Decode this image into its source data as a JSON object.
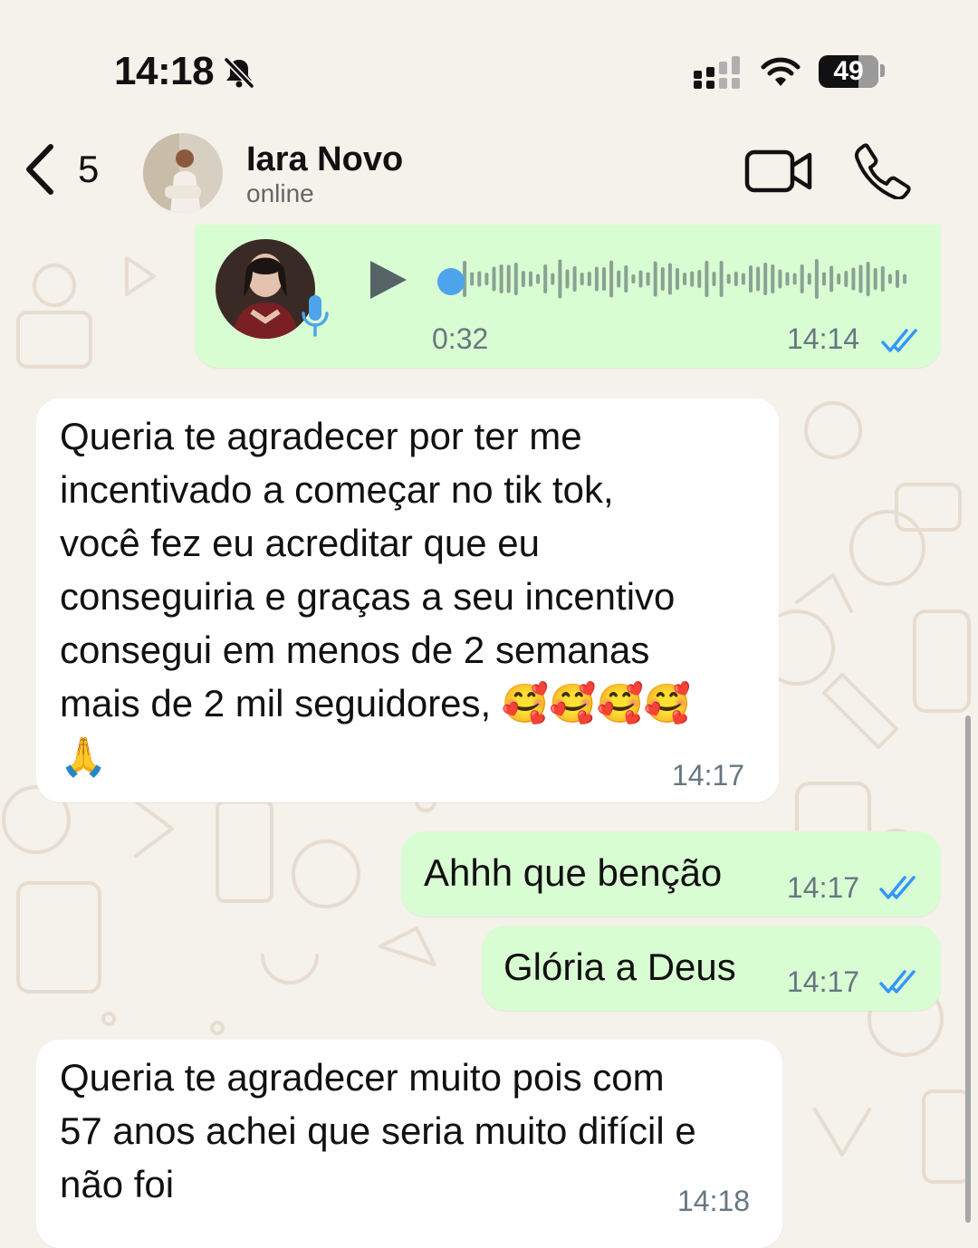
{
  "status_bar": {
    "time": "14:18",
    "battery": "49"
  },
  "header": {
    "back_count": "5",
    "contact_name": "Iara Novo",
    "contact_status": "online"
  },
  "messages": [
    {
      "type": "voice",
      "direction": "outgoing",
      "duration": "0:32",
      "time": "14:14",
      "read": true
    },
    {
      "type": "text",
      "direction": "incoming",
      "lines": [
        "Queria te agradecer por ter me",
        "incentivado a começar no tik tok,",
        "você fez eu acreditar que eu",
        "conseguiria e graças a seu incentivo",
        "consegui em menos de 2 semanas",
        "mais de 2 mil seguidores, 🥰🥰🥰🥰",
        "🙏"
      ],
      "time": "14:17"
    },
    {
      "type": "text",
      "direction": "outgoing",
      "text": "Ahhh que benção",
      "time": "14:17",
      "read": true
    },
    {
      "type": "text",
      "direction": "outgoing",
      "text": "Glória a Deus",
      "time": "14:17",
      "read": true
    },
    {
      "type": "text",
      "direction": "incoming",
      "lines": [
        "Queria te agradecer muito pois com",
        "57 anos achei que seria muito difícil e",
        "não foi"
      ],
      "time": "14:18"
    }
  ],
  "colors": {
    "outgoing_bubble": "#d9fdd3",
    "incoming_bubble": "#ffffff",
    "read_ticks": "#3497f9",
    "background": "#f5f1eb"
  }
}
